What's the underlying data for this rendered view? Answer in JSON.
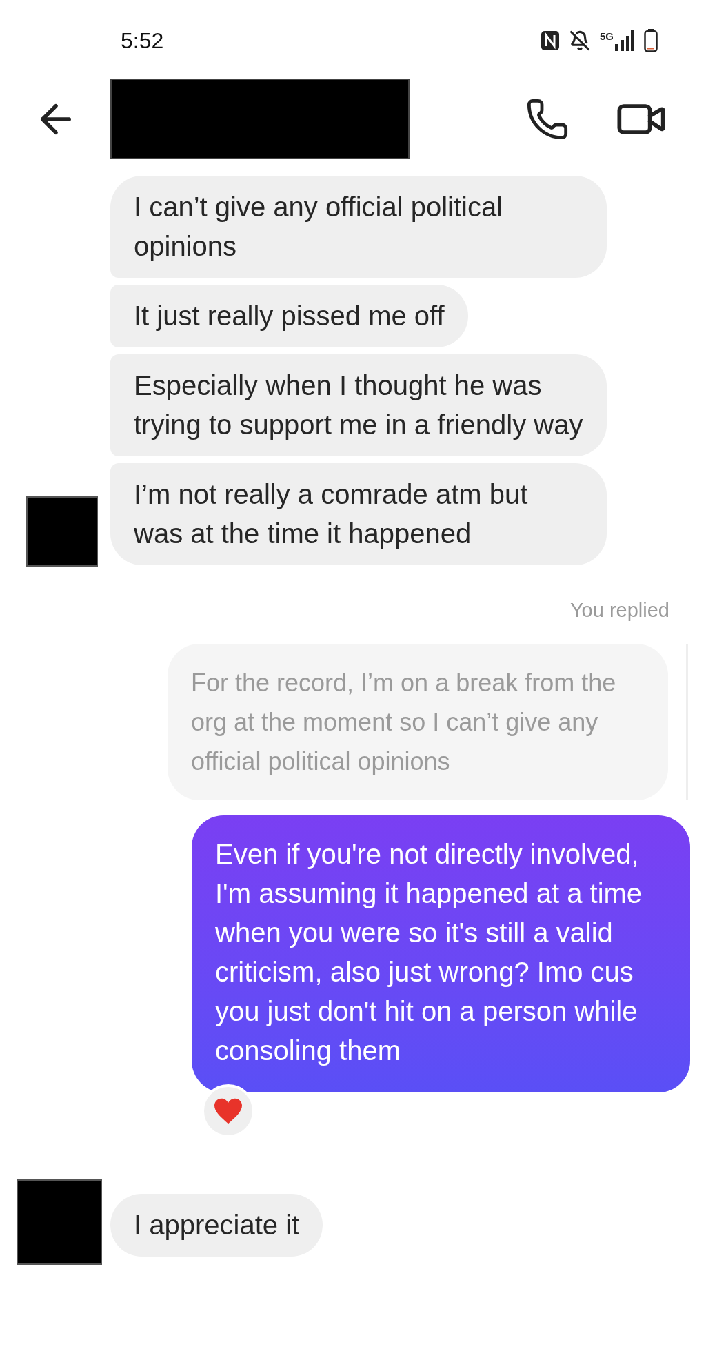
{
  "status_bar": {
    "time": "5:52",
    "network": "5G"
  },
  "messages": [
    {
      "kind": "incoming",
      "text": "I can’t give any official political opinions",
      "avatar": false
    },
    {
      "kind": "incoming",
      "text": "It just really pissed me off",
      "avatar": false
    },
    {
      "kind": "incoming",
      "text": "Especially when I thought he was trying to support me in a friendly way",
      "avatar": false
    },
    {
      "kind": "incoming",
      "text": "I’m not really a comrade atm but was at the time it happened",
      "avatar": true
    },
    {
      "kind": "reply_label",
      "text": "You replied"
    },
    {
      "kind": "quoted",
      "text": "For the record, I’m on a break from the org at the moment so I can’t give any official political opinions"
    },
    {
      "kind": "outgoing",
      "text": "Even if you're not directly involved, I'm assuming it happened at a time when you were so it's still a valid criticism, also just wrong? Imo cus you just don't hit on a person while consoling them",
      "reactions": [
        {
          "kind": "heart"
        }
      ]
    },
    {
      "kind": "incoming",
      "text": "I appreciate it",
      "avatar": true
    }
  ]
}
